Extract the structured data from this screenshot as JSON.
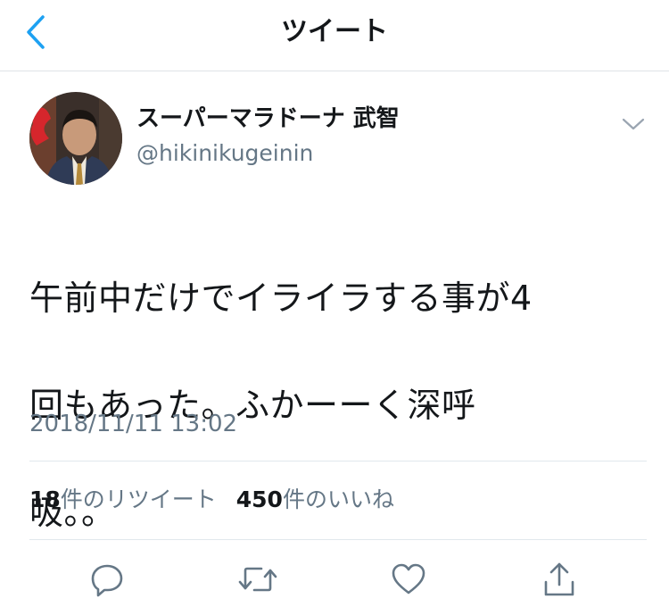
{
  "header": {
    "title": "ツイート",
    "back_icon": "chevron-left-icon"
  },
  "tweet": {
    "display_name": "スーパーマラドーナ 武智",
    "handle": "@hikinikugeinin",
    "text_lines": [
      "午前中だけでイライラする事が4",
      "回もあった。ふかーーく深呼",
      "吸。。"
    ],
    "timestamp": "2018/11/11 13:02"
  },
  "stats": {
    "retweets_count": "18",
    "retweets_label": "件のリツイート",
    "likes_count": "450",
    "likes_label": "件のいいね"
  },
  "actions": [
    "reply-icon",
    "retweet-icon",
    "like-icon",
    "share-icon"
  ],
  "colors": {
    "accent": "#1da1f2",
    "text": "#14171a",
    "muted": "#657786",
    "divider": "#e1e8ed"
  }
}
